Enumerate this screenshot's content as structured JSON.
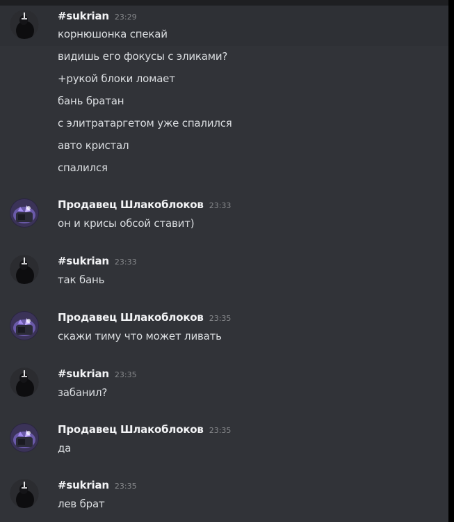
{
  "colors": {
    "background": "#313338",
    "hover_background": "#2e3035",
    "author_text": "#f2f3f5",
    "message_text": "#dbdee1",
    "timestamp_text": "#87898c"
  },
  "messages": [
    {
      "author": "#sukrian",
      "time": "23:29",
      "avatar_icon": "dark-figure-avatar-icon",
      "lines": [
        "корнюшонка спекай",
        "видишь его фокусы с эликами?",
        "+рукой блоки ломает",
        "бань братан",
        "с элитратаргетом уже спалился",
        "авто кристал",
        "спалился"
      ]
    },
    {
      "author": "Продавец Шлакоблоков",
      "time": "23:33",
      "avatar_icon": "purple-crystal-avatar-icon",
      "lines": [
        "он и крисы обсой ставит)"
      ]
    },
    {
      "author": "#sukrian",
      "time": "23:33",
      "avatar_icon": "dark-figure-avatar-icon",
      "lines": [
        "так бань"
      ]
    },
    {
      "author": "Продавец Шлакоблоков",
      "time": "23:35",
      "avatar_icon": "purple-crystal-avatar-icon",
      "lines": [
        "скажи тиму что может ливать"
      ]
    },
    {
      "author": "#sukrian",
      "time": "23:35",
      "avatar_icon": "dark-figure-avatar-icon",
      "lines": [
        "забанил?"
      ]
    },
    {
      "author": "Продавец Шлакоблоков",
      "time": "23:35",
      "avatar_icon": "purple-crystal-avatar-icon",
      "lines": [
        "да"
      ]
    },
    {
      "author": "#sukrian",
      "time": "23:35",
      "avatar_icon": "dark-figure-avatar-icon",
      "lines": [
        "лев брат"
      ]
    }
  ]
}
